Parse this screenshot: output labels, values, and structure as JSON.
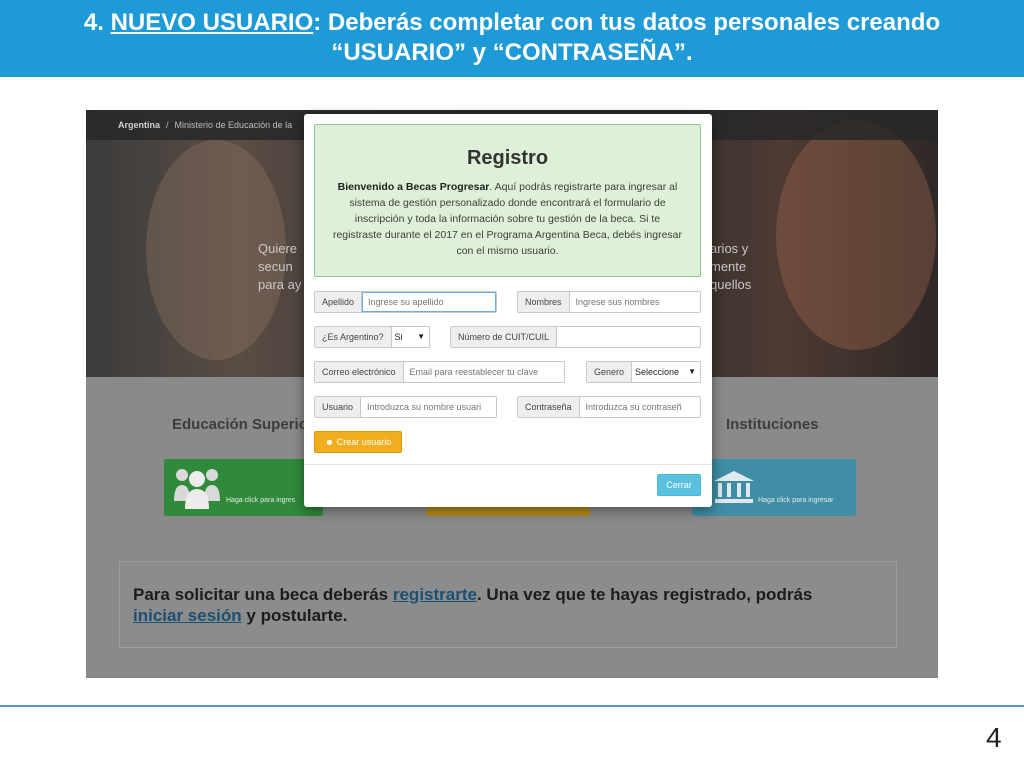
{
  "slide": {
    "title_prefix": "4. ",
    "title_underlined": "NUEVO USUARIO",
    "title_rest": ": Deberás completar con tus datos personales creando",
    "title_line2": "“USUARIO” y “CONTRASEÑA”.",
    "page_number": "4"
  },
  "site": {
    "breadcrumb_home": "Argentina",
    "breadcrumb_sep": "/",
    "breadcrumb_current": "Ministerio de Educación de la",
    "hero_left_lines": [
      "Quiere",
      "secun",
      "para ay"
    ],
    "hero_right_lines": [
      "arios y",
      "mente",
      "quellos"
    ],
    "section_left": "Educación Superio",
    "section_right": "Instituciones",
    "tile_green_label": "Haga click para ingres",
    "tile_blue_label": "Haga click para ingresar",
    "info_text_1": "Para solicitar una beca deberás ",
    "info_link_1": "registrarte",
    "info_text_2": ". Una vez que te hayas registrado, podrás",
    "info_link_2": "iniciar sesión",
    "info_text_3": " y postularte."
  },
  "modal": {
    "title": "Registro",
    "welcome_bold": "Bienvenido a Becas Progresar",
    "welcome_text": ". Aquí podrás registrarte para ingresar al sistema de gestión personalizado donde encontrará el formulario de inscripción y toda la información sobre tu gestión de la beca. Si te registraste durante el 2017 en el Programa Argentina Beca, debés ingresar con el mismo usuario.",
    "apellido_label": "Apellido",
    "apellido_placeholder": "Ingrese su apellido",
    "nombres_label": "Nombres",
    "nombres_placeholder": "Ingrese sus nombres",
    "argentino_label": "¿Es Argentino?",
    "argentino_value": "Si",
    "cuit_label": "Número de CUIT/CUIL",
    "cuit_placeholder": "",
    "correo_label": "Correo electrónico",
    "correo_placeholder": "Email para reestablecer tu clave",
    "genero_label": "Genero",
    "genero_value": "Seleccione",
    "usuario_label": "Usuario",
    "usuario_placeholder": "Introduzca su nombre usuari",
    "contrasena_label": "Contraseña",
    "contrasena_placeholder": "Introduzca su contraseñ",
    "create_button": "Crear usuario",
    "close_button": "Cerrar"
  },
  "colors": {
    "banner": "#1e9bd7",
    "welcome_bg": "#dff0d8",
    "create_button": "#f0ad1e",
    "close_button": "#5bc0de"
  }
}
